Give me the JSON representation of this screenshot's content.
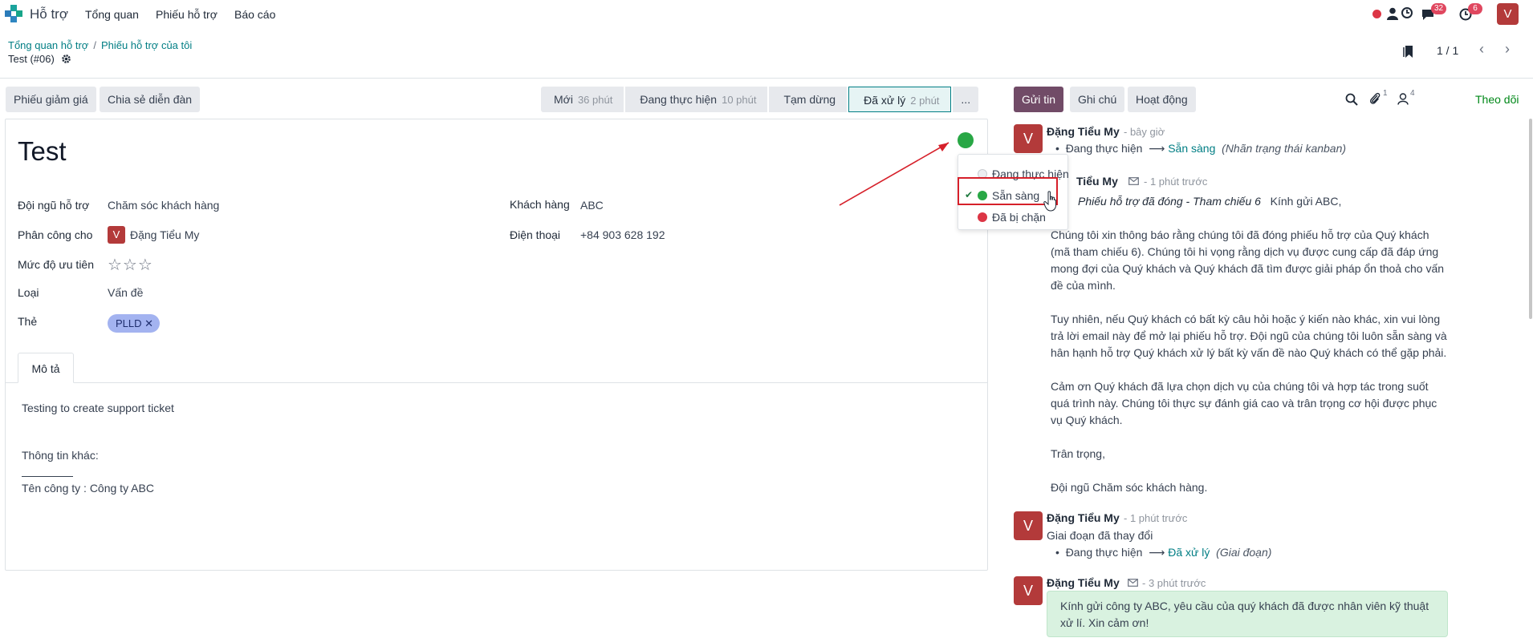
{
  "navbar": {
    "app_name": "Hỗ trợ",
    "menu": [
      "Tổng quan",
      "Phiếu hỗ trợ",
      "Báo cáo"
    ],
    "messages_count": "32",
    "activities_count": "6",
    "user_initial": "V"
  },
  "breadcrumb": {
    "parent": "Tổng quan hỗ trợ",
    "current": "Phiếu hỗ trợ của tôi"
  },
  "record": {
    "title": "Test (#06)"
  },
  "pager": {
    "value": "1 / 1"
  },
  "form_buttons": {
    "coupon": "Phiếu giảm giá",
    "share_forum": "Chia sẻ diễn đàn"
  },
  "stages": [
    {
      "name": "Mới",
      "duration": "36 phút"
    },
    {
      "name": "Đang thực hiện",
      "duration": "10 phút"
    },
    {
      "name": "Tạm dừng",
      "duration": ""
    },
    {
      "name": "Đã xử lý",
      "duration": "2 phút"
    },
    {
      "name": "...",
      "duration": ""
    }
  ],
  "form": {
    "title": "Test",
    "team_label": "Đội ngũ hỗ trợ",
    "team_value": "Chăm sóc khách hàng",
    "assigned_label": "Phân công cho",
    "assigned_value": "Đặng Tiểu My",
    "assigned_initial": "V",
    "priority_label": "Mức độ ưu tiên",
    "priority_stars": "☆☆☆",
    "type_label": "Loại",
    "type_value": "Vấn đề",
    "tags_label": "Thẻ",
    "tag_value": "PLLD",
    "customer_label": "Khách hàng",
    "customer_value": "ABC",
    "phone_label": "Điện thoại",
    "phone_value": "+84 903 628 192"
  },
  "tab": {
    "label": "Mô tả"
  },
  "description": {
    "line1": "Testing to create support ticket",
    "line2": "Thông tin khác:",
    "line3": "Tên công ty : Công ty ABC"
  },
  "kanban_state_dropdown": {
    "items": [
      {
        "label": "Đang thực hiện",
        "color": "#e5e7eb"
      },
      {
        "label": "Sẵn sàng",
        "color": "#28a745"
      },
      {
        "label": "Đã bị chặn",
        "color": "#dc3545"
      }
    ]
  },
  "chatter": {
    "send_label": "Gửi tin",
    "note_label": "Ghi chú",
    "activity_label": "Hoạt động",
    "attachments_count": "1",
    "followers_count": "4",
    "follow_label": "Theo dõi",
    "messages": [
      {
        "author": "Đặng Tiểu My",
        "time": "- bây giờ",
        "from": "Đang thực hiện",
        "to": "Sẵn sàng",
        "field": "(Nhãn trạng thái kanban)"
      },
      {
        "author": "Tiểu My",
        "time": "- 1 phút trước",
        "subject": "Phiếu hỗ trợ đã đóng - Tham chiếu 6",
        "greeting": "Kính gửi ABC,",
        "p1": [
          "Chúng tôi xin thông báo rằng chúng tôi đã đóng phiếu hỗ trợ của Quý khách",
          "(mã tham chiếu 6). Chúng tôi hi vọng rằng dịch vụ được cung cấp đã đáp ứng",
          "mong đợi của Quý khách và Quý khách đã tìm được giải pháp ổn thoả cho vấn",
          "đề của mình."
        ],
        "p2": [
          "Tuy nhiên, nếu Quý khách có bất kỳ câu hỏi hoặc ý kiến nào khác, xin vui lòng",
          "trả lời email này để mở lại phiếu hỗ trợ. Đội ngũ của chúng tôi luôn sẵn sàng và",
          "hân hạnh hỗ trợ Quý khách xử lý bất kỳ vấn đề nào Quý khách có thể gặp phải."
        ],
        "p3": [
          "Cảm ơn Quý khách đã lựa chọn dịch vụ của chúng tôi và hợp tác trong suốt",
          "quá trình này. Chúng tôi thực sự đánh giá cao và trân trọng cơ hội được phục",
          "vụ Quý khách."
        ],
        "p4": "Trân trọng,",
        "p5": "Đội ngũ Chăm sóc khách hàng."
      },
      {
        "author": "Đặng Tiểu My",
        "time": "- 1 phút trước",
        "body": "Giai đoạn đã thay đổi",
        "from": "Đang thực hiện",
        "to": "Đã xử lý",
        "field": "(Giai đoạn)"
      },
      {
        "author": "Đặng Tiểu My",
        "time": "- 3 phút trước",
        "body_line1": "Kính gửi công ty ABC, yêu cầu của quý khách đã được nhân viên kỹ thuật",
        "body_line2": "xử lí. Xin cảm ơn!"
      }
    ]
  },
  "colors": {
    "brand": "#714b67",
    "accent": "#017e84",
    "ready": "#28a745",
    "blocked": "#dc3545",
    "annotation": "#d6202a"
  }
}
